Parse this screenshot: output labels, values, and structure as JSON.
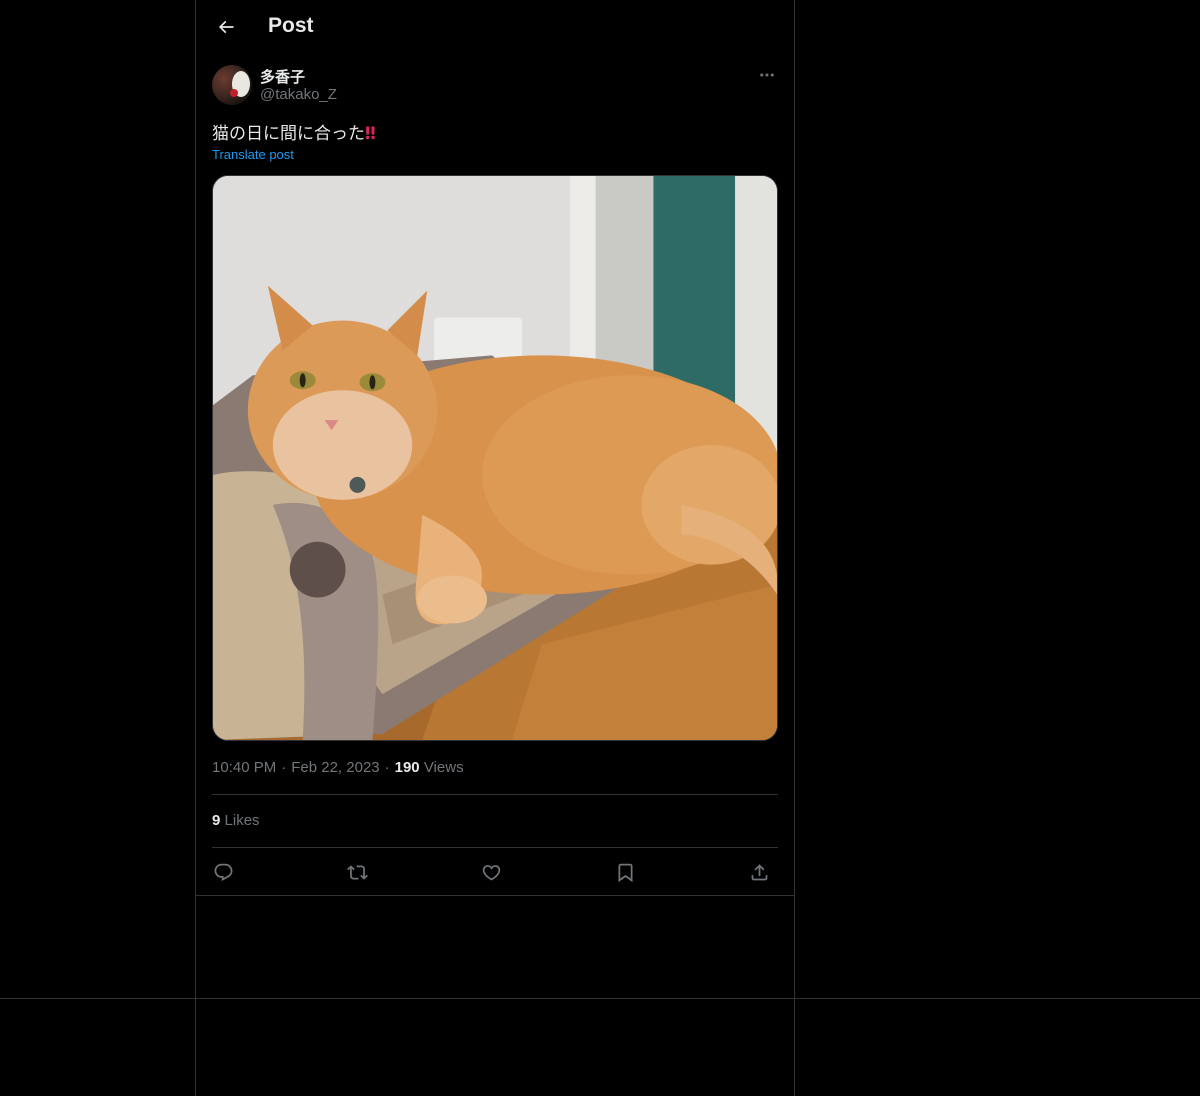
{
  "header": {
    "title": "Post",
    "back_icon": "arrow-left-icon"
  },
  "post": {
    "author": {
      "display_name": "多香子",
      "handle": "@takako_Z"
    },
    "text": "猫の日に間に合った",
    "text_emoji": "‼",
    "translate_label": "Translate post",
    "image_alt": "Fluffy orange cat lying on a cardboard scratcher sofa",
    "meta": {
      "time": "10:40 PM",
      "separator": "·",
      "date": "Feb 22, 2023",
      "views_count": "190",
      "views_label": "Views"
    },
    "likes": {
      "count": "9",
      "label": "Likes"
    }
  },
  "actions": [
    {
      "name": "reply",
      "icon": "reply-icon"
    },
    {
      "name": "repost",
      "icon": "repost-icon"
    },
    {
      "name": "like",
      "icon": "heart-icon"
    },
    {
      "name": "bookmark",
      "icon": "bookmark-icon"
    },
    {
      "name": "share",
      "icon": "share-icon"
    }
  ],
  "colors": {
    "background": "#000000",
    "text_primary": "#e7e9ea",
    "text_secondary": "#71767b",
    "link": "#1d9bf0",
    "border": "#2f3336",
    "emoji_red": "#e0245e"
  }
}
